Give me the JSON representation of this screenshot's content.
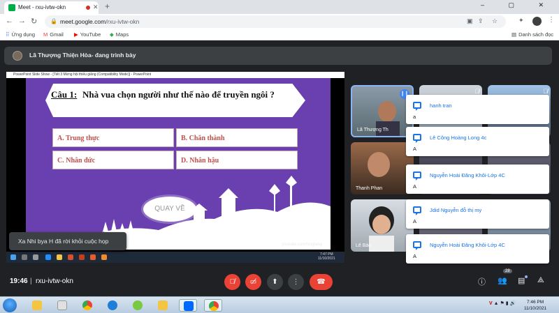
{
  "browser": {
    "tab_title": "Meet - rxu-ivtw-okn",
    "new_tab": "+",
    "url_host": "meet.google.com",
    "url_path": "/rxu-ivtw-okn",
    "window_controls": "–  ▢  ✕",
    "bookmarks": [
      {
        "icon": "grid-icon",
        "label": "Ứng dụng"
      },
      {
        "icon": "gmail-icon",
        "label": "Gmail"
      },
      {
        "icon": "youtube-icon",
        "label": "YouTube"
      },
      {
        "icon": "maps-icon",
        "label": "Maps"
      }
    ],
    "reading_list": "Danh sách đọc"
  },
  "presenter": {
    "label": "Lã Thượng Thiện Hòa- đang trình bày"
  },
  "presentation": {
    "window_title": "PowerPoint Slide Show - [Tiết 3 Mừng hội thiếu giảng (Compatibility Mode)] - PowerPoint",
    "question_prefix": "Câu 1:",
    "question_text": "Nhà vua chọn người như thế nào để truyền ngôi ?",
    "answers": [
      "A. Trung thực",
      "B. Chăn thành",
      "C. Nhân đức",
      "D. Nhân hậu"
    ],
    "back_button": "QUAY VỀ",
    "credit": "youtube.com/troglang",
    "inner_time": "7:47 PM",
    "inner_date": "11/10/2021"
  },
  "participants": [
    {
      "name": "Lã Thượng Th",
      "speaking": true
    },
    {
      "name": "",
      "muted": true
    },
    {
      "name": "",
      "muted": true
    },
    {
      "name": "Thanh Phan",
      "muted": false
    },
    {
      "name": "",
      "muted": false
    },
    {
      "name": "Lê Bảo",
      "muted": false
    }
  ],
  "chat_messages": [
    {
      "sender": "hanh tran",
      "message": "a"
    },
    {
      "sender": "Lê Công Hoàng Long 4c",
      "message": "A"
    },
    {
      "sender": "Nguyễn Hoài Đăng Khôi-Lớp 4C",
      "message": "A"
    },
    {
      "sender": "Jdid Nguyễn đỗ thị my",
      "message": "A"
    },
    {
      "sender": "Nguyễn Hoài Đăng Khôi-Lớp 4C",
      "message": "A"
    }
  ],
  "toast": "Xa Nhi bya H đã rời khỏi cuộc họp",
  "meeting": {
    "time": "19:46",
    "separator": "|",
    "code": "rxu-ivtw-okn",
    "participant_count": "28"
  },
  "taskbar": {
    "time": "7:46 PM",
    "date": "11/10/2021",
    "tray": "V"
  },
  "colors": {
    "slide_bg": "#6a3fb0",
    "answer_text": "#c0504d",
    "hangup": "#ea4335",
    "chat_accent": "#1a73e8"
  }
}
